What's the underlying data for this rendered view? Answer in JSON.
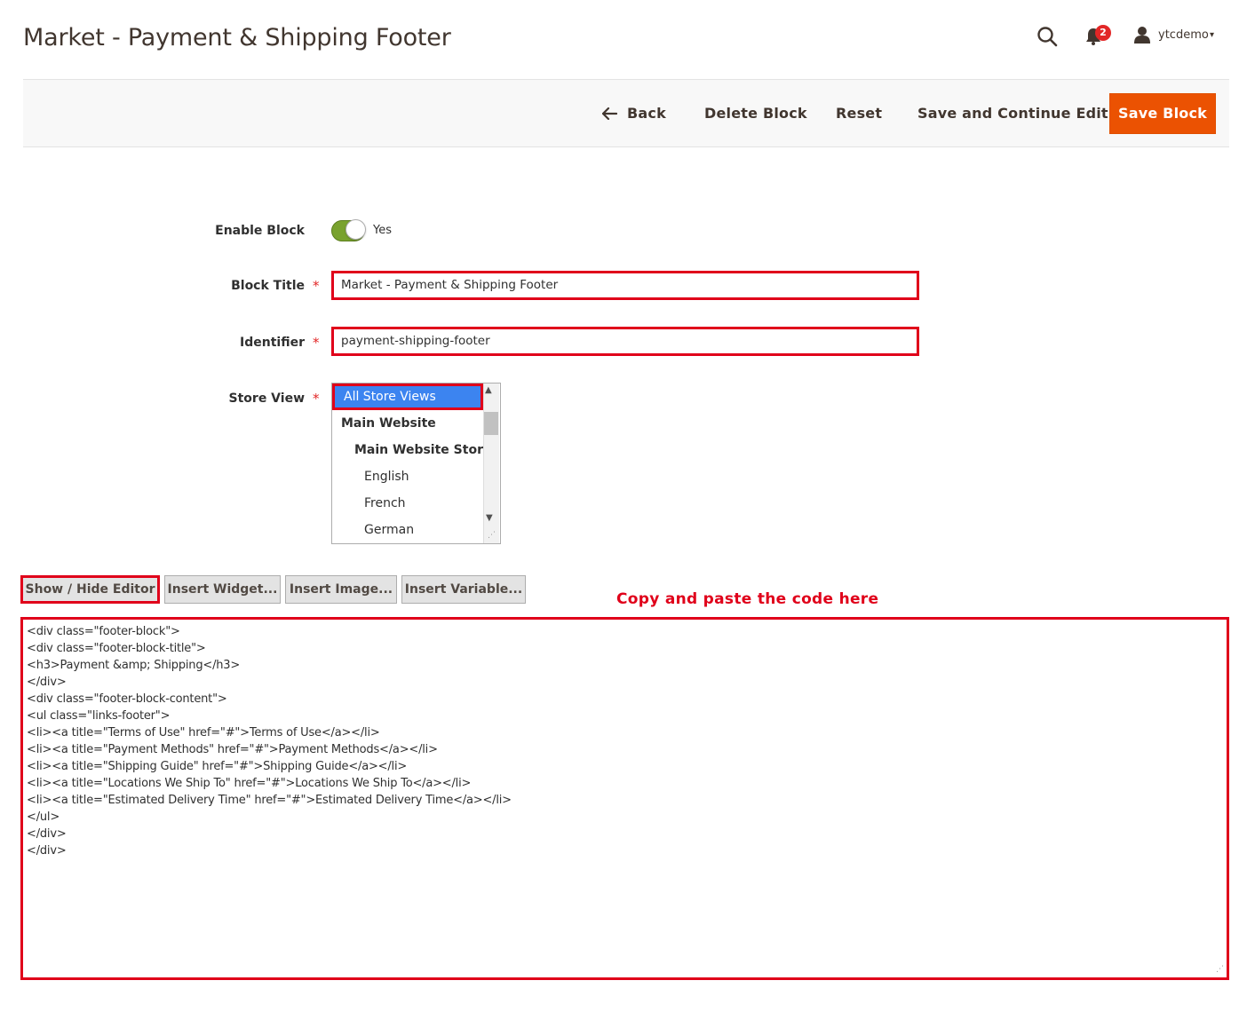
{
  "header": {
    "title": "Market - Payment & Shipping Footer",
    "notification_count": "2",
    "user": "ytcdemo",
    "user_caret": "▾"
  },
  "actions": {
    "back": "Back",
    "delete": "Delete Block",
    "reset": "Reset",
    "save_continue": "Save and Continue Edit",
    "save": "Save Block"
  },
  "form": {
    "enable_label": "Enable Block",
    "enable_value": "Yes",
    "title_label": "Block Title",
    "title_value": "Market - Payment & Shipping Footer",
    "identifier_label": "Identifier",
    "identifier_value": "payment-shipping-footer",
    "store_view_label": "Store View",
    "required_mark": "*",
    "store_views": [
      "All Store Views",
      "Main Website",
      "Main Website Store",
      "English",
      "French",
      "German"
    ]
  },
  "editor": {
    "show_hide": "Show / Hide Editor",
    "insert_widget": "Insert Widget...",
    "insert_image": "Insert Image...",
    "insert_variable": "Insert Variable...",
    "annotation": "Copy and paste the code here",
    "code_lines": [
      "<div class=\"footer-block\">",
      "<div class=\"footer-block-title\">",
      "<h3>Payment &amp; Shipping</h3>",
      "</div>",
      "<div class=\"footer-block-content\">",
      "<ul class=\"links-footer\">",
      "<li><a title=\"Terms of Use\" href=\"#\">Terms of Use</a></li>",
      "<li><a title=\"Payment Methods\" href=\"#\">Payment Methods</a></li>",
      "<li><a title=\"Shipping Guide\" href=\"#\">Shipping Guide</a></li>",
      "<li><a title=\"Locations We Ship To\" href=\"#\">Locations We Ship To</a></li>",
      "<li><a title=\"Estimated Delivery Time\" href=\"#\">Estimated Delivery Time</a></li>",
      "</ul>",
      "</div>",
      "</div>"
    ]
  },
  "colors": {
    "accent": "#eb5202",
    "highlight_border": "#e0001a",
    "toggle_on": "#79a22e",
    "selected_option": "#3c84f0"
  }
}
